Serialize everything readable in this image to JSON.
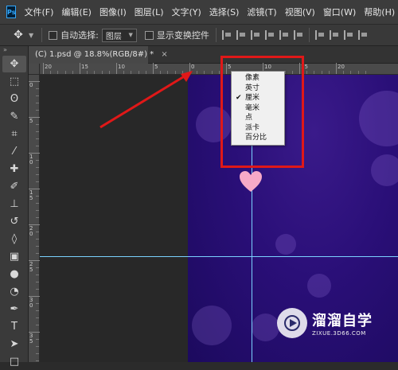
{
  "app": {
    "logo_text": "Ps",
    "menu": [
      "文件(F)",
      "编辑(E)",
      "图像(I)",
      "图层(L)",
      "文字(Y)",
      "选择(S)",
      "滤镜(T)",
      "视图(V)",
      "窗口(W)",
      "帮助(H)"
    ]
  },
  "options_bar": {
    "move_icon": "✥",
    "auto_select_label": "自动选择:",
    "auto_select_value": "图层",
    "show_transform_label": "显示变换控件"
  },
  "document_tab": {
    "title": "(C) 1.psd @ 18.8%(RGB/8#) *",
    "close": "×"
  },
  "ruler_h_labels": [
    "20",
    "15",
    "10",
    "5",
    "0",
    "5",
    "10",
    "15",
    "20"
  ],
  "ruler_v_labels": [
    "0",
    "5",
    "1 0",
    "1 5",
    "2 0",
    "2 5",
    "3 0",
    "3 5"
  ],
  "context_menu": {
    "items": [
      {
        "label": "像素",
        "checked": false
      },
      {
        "label": "英寸",
        "checked": false
      },
      {
        "label": "厘米",
        "checked": true
      },
      {
        "label": "毫米",
        "checked": false
      },
      {
        "label": "点",
        "checked": false
      },
      {
        "label": "派卡",
        "checked": false
      },
      {
        "label": "百分比",
        "checked": false
      }
    ],
    "check_glyph": "✔"
  },
  "tools": [
    {
      "name": "move-tool-icon",
      "glyph": "✥"
    },
    {
      "name": "marquee-tool-icon",
      "glyph": "⬚"
    },
    {
      "name": "lasso-tool-icon",
      "glyph": "ʘ"
    },
    {
      "name": "quick-select-tool-icon",
      "glyph": "✎"
    },
    {
      "name": "crop-tool-icon",
      "glyph": "⌗"
    },
    {
      "name": "eyedropper-tool-icon",
      "glyph": "⁄"
    },
    {
      "name": "healing-brush-tool-icon",
      "glyph": "✚"
    },
    {
      "name": "brush-tool-icon",
      "glyph": "✐"
    },
    {
      "name": "clone-stamp-tool-icon",
      "glyph": "⊥"
    },
    {
      "name": "history-brush-tool-icon",
      "glyph": "↺"
    },
    {
      "name": "eraser-tool-icon",
      "glyph": "◊"
    },
    {
      "name": "gradient-tool-icon",
      "glyph": "▣"
    },
    {
      "name": "blur-tool-icon",
      "glyph": "●"
    },
    {
      "name": "dodge-tool-icon",
      "glyph": "◔"
    },
    {
      "name": "pen-tool-icon",
      "glyph": "✒"
    },
    {
      "name": "type-tool-icon",
      "glyph": "T"
    },
    {
      "name": "path-select-tool-icon",
      "glyph": "➤"
    },
    {
      "name": "shape-tool-icon",
      "glyph": "□"
    }
  ],
  "watermark": {
    "title": "溜溜自学",
    "subtitle": "ZIXUE.3D66.COM"
  },
  "colors": {
    "accent_red": "#e01818",
    "guide": "#7ad2ff",
    "canvas": "#2a0f78"
  }
}
